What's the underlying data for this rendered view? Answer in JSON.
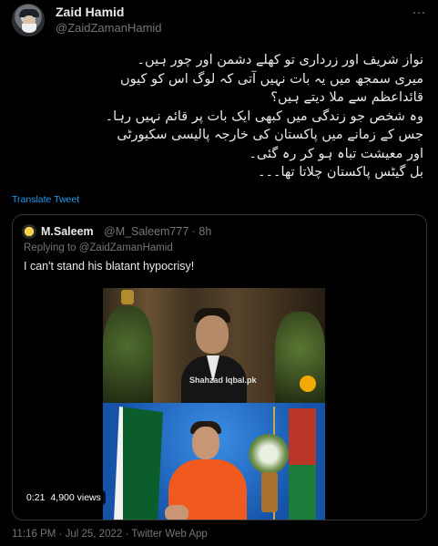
{
  "author": {
    "name": "Zaid Hamid",
    "handle": "@ZaidZamanHamid"
  },
  "more_icon": "…",
  "body_lines": [
    "نواز شریف اور زرداری تو کھلے دشمن اور چور ہیں۔",
    "میری سمجھ میں یہ بات نہیں آتی کہ لوگ اس کو کیوں",
    "قائداعظم سے ملا دیتے ہیں؟",
    "وہ شخص جو زندگی میں کبھی ایک بات پر قائم نہیں رہا۔",
    "جس کے زمانے میں پاکستان کی خارجہ پالیسی سکیورٹی",
    "اور معیشت تباہ ہو کر رہ گئی۔",
    "بل گیٹس پاکستان چلاتا تھا۔۔۔"
  ],
  "translate_label": "Translate Tweet",
  "quote": {
    "name": "M.Saleem",
    "handle_time": "@M_Saleem777 · 8h",
    "replying_prefix": "Replying to ",
    "replying_to": "@ZaidZamanHamid",
    "text": "I can't stand his blatant hypocrisy!",
    "video": {
      "watermark": "Shahzad Iqbal.pk",
      "time": "0:21",
      "views": "4,900 views"
    }
  },
  "footer": "11:16 PM · Jul 25, 2022 · Twitter Web App"
}
